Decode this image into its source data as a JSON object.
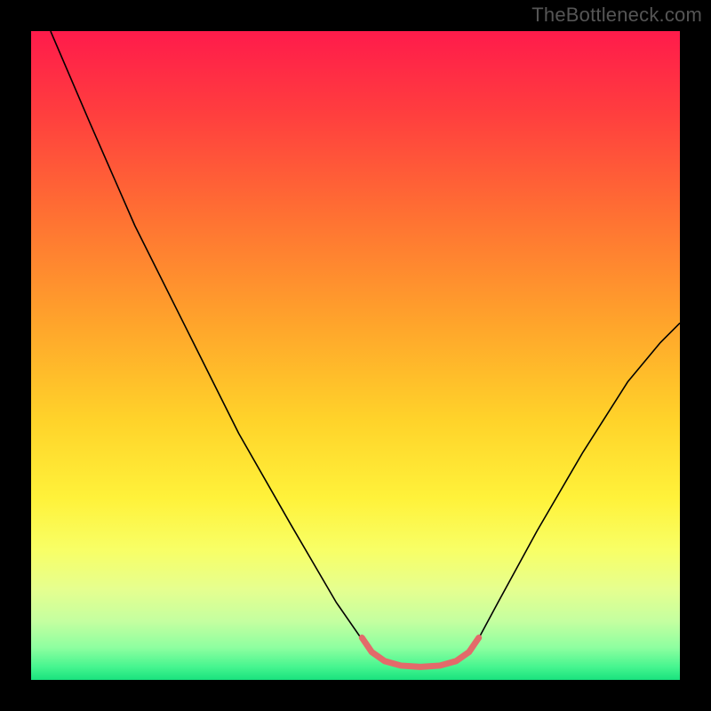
{
  "watermark": "TheBottleneck.com",
  "chart_data": {
    "type": "line",
    "title": "",
    "xlabel": "",
    "ylabel": "",
    "xlim": [
      0,
      100
    ],
    "ylim": [
      0,
      100
    ],
    "grid": false,
    "gradient_stops": [
      {
        "offset": 0.0,
        "color": "#ff1b4b"
      },
      {
        "offset": 0.12,
        "color": "#ff3c3f"
      },
      {
        "offset": 0.28,
        "color": "#ff6f33"
      },
      {
        "offset": 0.45,
        "color": "#ffa42b"
      },
      {
        "offset": 0.6,
        "color": "#ffd32a"
      },
      {
        "offset": 0.72,
        "color": "#fff23a"
      },
      {
        "offset": 0.8,
        "color": "#f8ff66"
      },
      {
        "offset": 0.86,
        "color": "#e6ff8f"
      },
      {
        "offset": 0.91,
        "color": "#c4ffa0"
      },
      {
        "offset": 0.95,
        "color": "#8effa0"
      },
      {
        "offset": 0.98,
        "color": "#46f58f"
      },
      {
        "offset": 1.0,
        "color": "#19e27e"
      }
    ],
    "series": [
      {
        "name": "bottleneck-curve",
        "stroke": "#000000",
        "stroke_width": 1.6,
        "points": [
          {
            "x": 3.0,
            "y": 100.0
          },
          {
            "x": 9.0,
            "y": 86.0
          },
          {
            "x": 16.0,
            "y": 70.0
          },
          {
            "x": 24.0,
            "y": 54.0
          },
          {
            "x": 32.0,
            "y": 38.0
          },
          {
            "x": 40.0,
            "y": 24.0
          },
          {
            "x": 47.0,
            "y": 12.0
          },
          {
            "x": 51.5,
            "y": 5.5
          },
          {
            "x": 53.5,
            "y": 3.2
          },
          {
            "x": 58.0,
            "y": 2.3
          },
          {
            "x": 62.5,
            "y": 2.3
          },
          {
            "x": 66.5,
            "y": 3.2
          },
          {
            "x": 68.5,
            "y": 5.5
          },
          {
            "x": 72.0,
            "y": 12.0
          },
          {
            "x": 78.0,
            "y": 23.0
          },
          {
            "x": 85.0,
            "y": 35.0
          },
          {
            "x": 92.0,
            "y": 46.0
          },
          {
            "x": 97.0,
            "y": 52.0
          },
          {
            "x": 100.0,
            "y": 55.0
          }
        ]
      },
      {
        "name": "sweet-spot",
        "stroke": "#e36a6a",
        "stroke_width": 7,
        "linecap": "round",
        "points": [
          {
            "x": 51.0,
            "y": 6.5
          },
          {
            "x": 52.5,
            "y": 4.3
          },
          {
            "x": 54.5,
            "y": 2.9
          },
          {
            "x": 57.0,
            "y": 2.2
          },
          {
            "x": 60.0,
            "y": 2.0
          },
          {
            "x": 63.0,
            "y": 2.2
          },
          {
            "x": 65.5,
            "y": 2.9
          },
          {
            "x": 67.5,
            "y": 4.3
          },
          {
            "x": 69.0,
            "y": 6.5
          }
        ]
      }
    ]
  }
}
